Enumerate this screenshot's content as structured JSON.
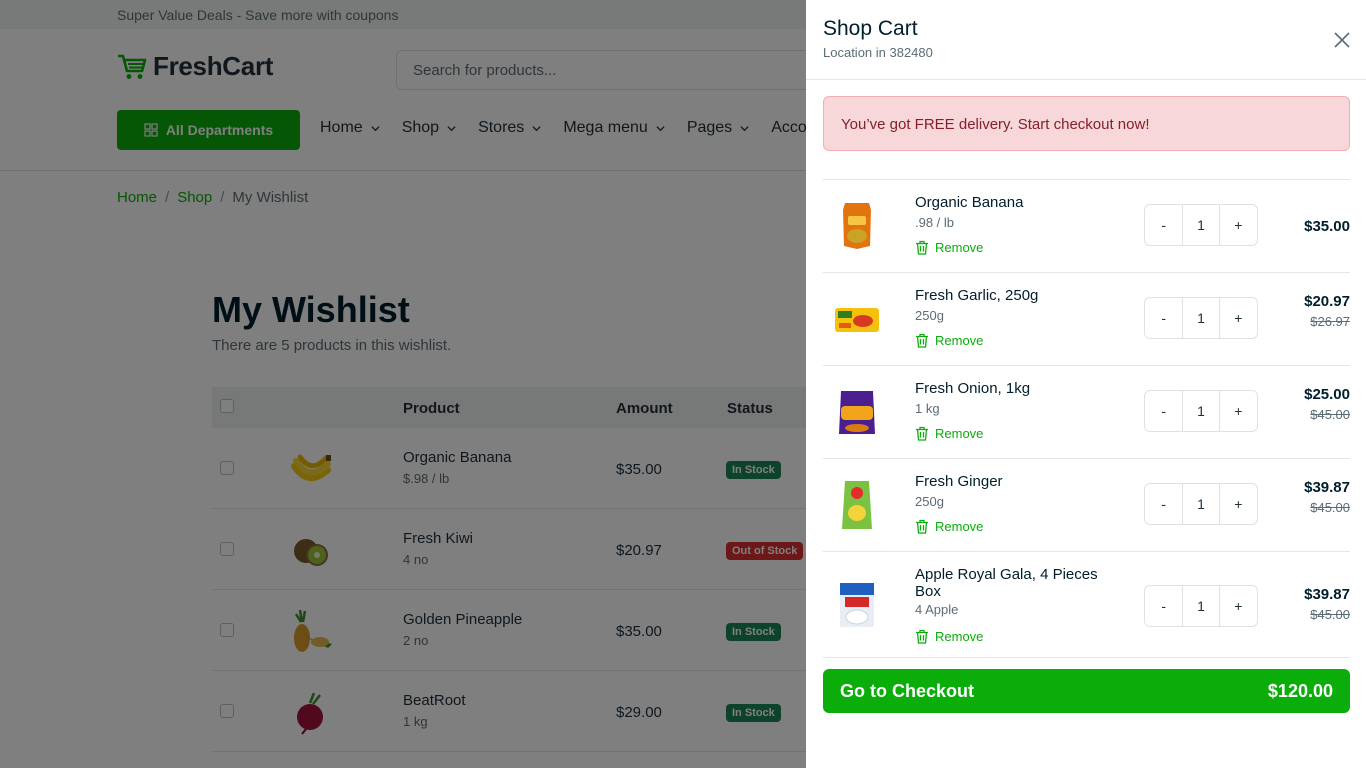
{
  "topbar": {
    "text": "Super Value Deals - Save more with coupons"
  },
  "header": {
    "logo_text": "FreshCart",
    "search_placeholder": "Search for products...",
    "departments_label": "All Departments",
    "nav": [
      "Home",
      "Shop",
      "Stores",
      "Mega menu",
      "Pages",
      "Account"
    ]
  },
  "breadcrumb": {
    "items": [
      "Home",
      "Shop"
    ],
    "current": "My Wishlist",
    "separator": "/"
  },
  "wishlist": {
    "title": "My Wishlist",
    "subtitle": "There are 5 products in this wishlist.",
    "columns": {
      "product": "Product",
      "amount": "Amount",
      "status": "Status"
    },
    "rows": [
      {
        "name": "Organic Banana",
        "meta": "$.98 / lb",
        "amount": "$35.00",
        "status": "In Stock"
      },
      {
        "name": "Fresh Kiwi",
        "meta": "4 no",
        "amount": "$20.97",
        "status": "Out of Stock"
      },
      {
        "name": "Golden Pineapple",
        "meta": "2 no",
        "amount": "$35.00",
        "status": "In Stock"
      },
      {
        "name": "BeatRoot",
        "meta": "1 kg",
        "amount": "$29.00",
        "status": "In Stock"
      }
    ]
  },
  "cart": {
    "title": "Shop Cart",
    "location": "Location in 382480",
    "alert": "You’ve got FREE delivery. Start checkout now!",
    "remove_label": "Remove",
    "minus": "-",
    "plus": "+",
    "items": [
      {
        "name": "Organic Banana",
        "meta": ".98 / lb",
        "qty": "1",
        "price": "$35.00",
        "old_price": ""
      },
      {
        "name": "Fresh Garlic, 250g",
        "meta": "250g",
        "qty": "1",
        "price": "$20.97",
        "old_price": "$26.97"
      },
      {
        "name": "Fresh Onion, 1kg",
        "meta": "1 kg",
        "qty": "1",
        "price": "$25.00",
        "old_price": "$45.00"
      },
      {
        "name": "Fresh Ginger",
        "meta": "250g",
        "qty": "1",
        "price": "$39.87",
        "old_price": "$45.00"
      },
      {
        "name": "Apple Royal Gala, 4 Pieces Box",
        "meta": "4 Apple",
        "qty": "1",
        "price": "$39.87",
        "old_price": "$45.00"
      }
    ],
    "checkout_label": "Go to Checkout",
    "checkout_total": "$120.00"
  },
  "colors": {
    "brand": "#0aad0a",
    "alert_bg": "#f8d7da",
    "alert_text": "#842029",
    "in_stock": "#198754",
    "out_of_stock": "#db3030"
  }
}
